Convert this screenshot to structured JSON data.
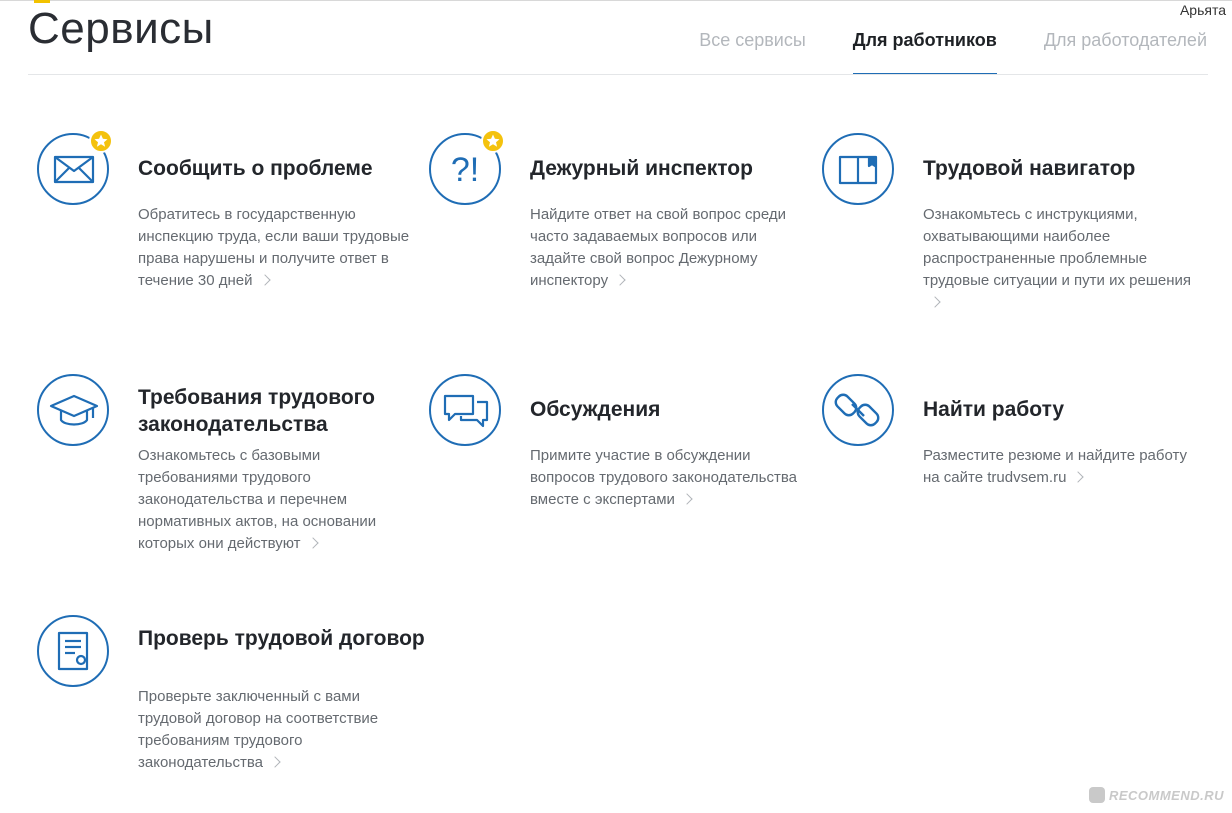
{
  "user": {
    "name": "Арьята"
  },
  "page": {
    "title": "Сервисы"
  },
  "tabs": [
    {
      "label": "Все сервисы",
      "active": false
    },
    {
      "label": "Для работников",
      "active": true
    },
    {
      "label": "Для работодателей",
      "active": false
    }
  ],
  "cards": [
    {
      "title": "Сообщить о проблеме",
      "description": "Обратитесь в государственную инспекцию труда, если ваши трудовые права нарушены и получите ответ в течение 30 дней",
      "icon": "envelope-icon",
      "starred": true
    },
    {
      "title": "Дежурный инспектор",
      "description": "Найдите ответ на свой вопрос среди часто задаваемых вопросов или задайте свой вопрос Дежурному инспектору",
      "icon": "question-exclamation-icon",
      "starred": true
    },
    {
      "title": "Трудовой навигатор",
      "description": "Ознакомьтесь с инструкциями, охватывающими наиболее распространенные проблемные трудовые ситуации и пути их решения",
      "icon": "book-icon",
      "starred": false
    },
    {
      "title": "Требования трудового законодательства",
      "description": "Ознакомьтесь с базовыми требованиями трудового законодательства и перечнем нормативных актов, на основании которых они действуют",
      "icon": "graduation-cap-icon",
      "starred": false
    },
    {
      "title": "Обсуждения",
      "description": "Примите участие в обсуждении вопросов трудового законодательства вместе с экспертами",
      "icon": "chat-bubbles-icon",
      "starred": false
    },
    {
      "title": "Найти работу",
      "description": "Разместите резюме и найдите работу на сайте trudvsem.ru",
      "icon": "link-icon",
      "starred": false
    },
    {
      "title": "Проверь трудовой договор",
      "description": "Проверьте заключенный с вами трудовой договор на соответствие требованиям трудового законодательства",
      "icon": "contract-document-icon",
      "starred": false
    }
  ],
  "watermark": {
    "text": "RECOMMEND.RU"
  },
  "colors": {
    "accent": "#1f6db5",
    "star": "#f4c20d",
    "title": "#23262b",
    "muted": "#656a70",
    "tab_inactive": "#b3b7bc"
  }
}
